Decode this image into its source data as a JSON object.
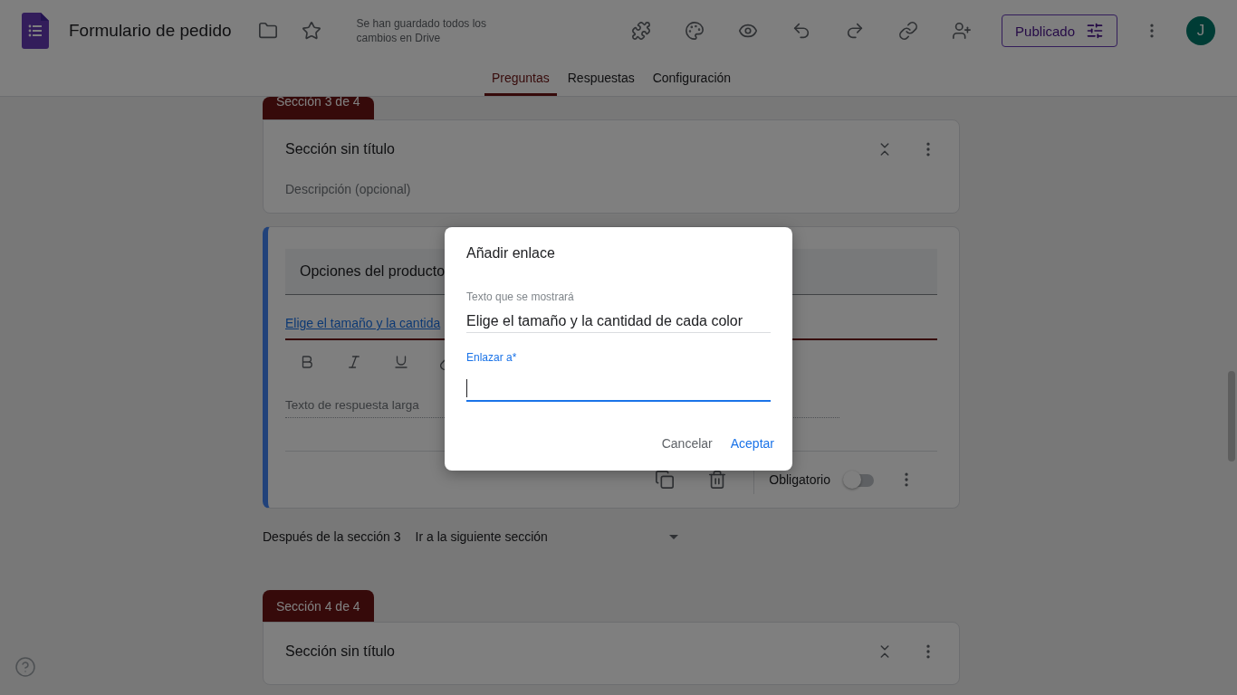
{
  "header": {
    "title": "Formulario de pedido",
    "save_status": "Se han guardado todos los cambios en Drive",
    "publish_button": "Publicado",
    "avatar": "J"
  },
  "tabs": [
    {
      "label": "Preguntas",
      "selected": true
    },
    {
      "label": "Respuestas",
      "selected": false
    },
    {
      "label": "Configuración",
      "selected": false
    }
  ],
  "section_3": {
    "badge": "Sección 3 de 4",
    "title": "Sección sin título",
    "description_placeholder": "Descripción (opcional)"
  },
  "question": {
    "title": "Opciones del producto",
    "description_link": "Elige el tamaño y la cantida",
    "answer_placeholder": "Texto de respuesta larga",
    "required_label": "Obligatorio",
    "required": false
  },
  "after_section": {
    "label": "Después de la sección 3",
    "value": "Ir a la siguiente sección"
  },
  "section_4": {
    "badge": "Sección 4 de 4",
    "title": "Sección sin título"
  },
  "dialog": {
    "title": "Añadir enlace",
    "fields": [
      {
        "label": "Texto que se mostrará",
        "value": "Elige el tamaño y la cantidad de cada color",
        "focused": false
      },
      {
        "label": "Enlazar a*",
        "focused": true
      }
    ],
    "buttons": [
      {
        "label": "Cancelar",
        "kind": "secondary"
      },
      {
        "label": "Aceptar",
        "kind": "primary"
      }
    ]
  }
}
